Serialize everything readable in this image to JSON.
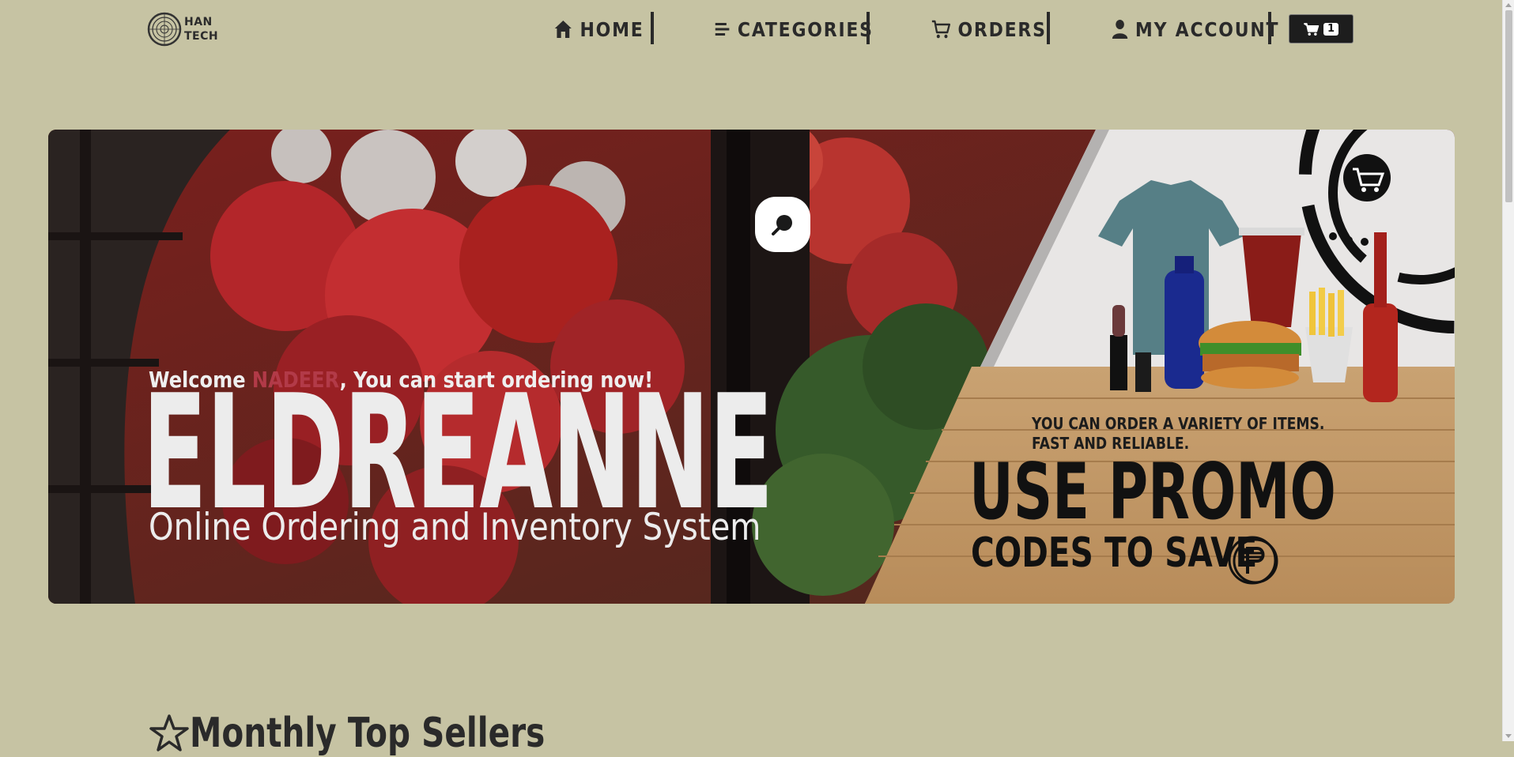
{
  "logo": {
    "line1": "HAN",
    "line2": "TECH",
    "icon": "han-tech-logo-icon"
  },
  "nav": {
    "items": [
      {
        "label": "HOME",
        "icon": "home-icon"
      },
      {
        "label": "CATEGORIES",
        "icon": "list-icon"
      },
      {
        "label": "ORDERS",
        "icon": "cart-icon"
      },
      {
        "label": "MY ACCOUNT",
        "icon": "user-icon"
      }
    ],
    "cart": {
      "count": "1",
      "icon": "cart-icon"
    }
  },
  "hero": {
    "welcome_prefix": "Welcome ",
    "username": "NADEER",
    "welcome_suffix": ", You can start ordering now!",
    "brand": "ELDREANNE",
    "tagline": "Online Ordering and Inventory System",
    "search_icon": "search-icon",
    "promo": {
      "line1": "YOU CAN ORDER A VARIETY OF ITEMS.",
      "line2": "FAST AND RELIABLE.",
      "headline": "USE PROMO",
      "subheadline": "CODES TO SAVE",
      "currency_icon": "peso-coin-icon",
      "cart_icon": "shopping-cart-icon"
    }
  },
  "section": {
    "title": "Monthly Top Sellers",
    "icon": "star-icon"
  },
  "colors": {
    "background": "#c6c3a3",
    "text": "#2a2a2a",
    "accent_red": "#b23a48"
  }
}
